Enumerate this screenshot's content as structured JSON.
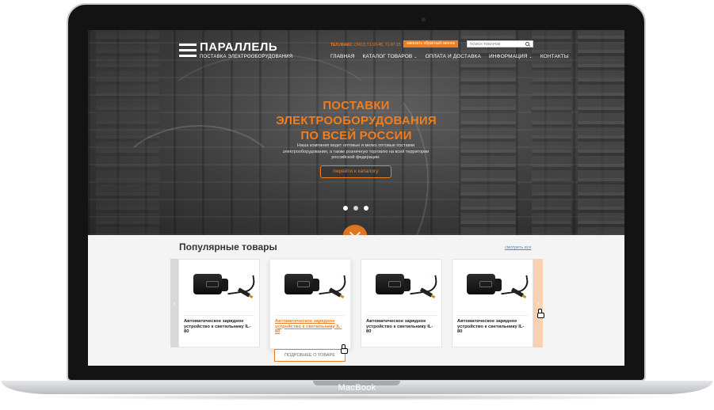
{
  "device": {
    "brand_label": "MacBook"
  },
  "header": {
    "logo_name": "ПАРАЛЛЕЛЬ",
    "logo_sub": "ПОСТАВКА ЭЛЕКТРООБОРУДОВАНИЯ",
    "phone_label": "ТЕЛ./ФАКС:",
    "phone_value": "(3412) 71-93-45, 71-97-15",
    "callback_label": "заказать обратный звонок",
    "search_placeholder": "ПОИСК ТОВАРОВ",
    "nav": [
      {
        "label": "ГЛАВНАЯ",
        "has_dropdown": false
      },
      {
        "label": "КАТАЛОГ ТОВАРОВ",
        "has_dropdown": true
      },
      {
        "label": "ОПЛАТА И ДОСТАВКА",
        "has_dropdown": false
      },
      {
        "label": "ИНФОРМАЦИЯ",
        "has_dropdown": true
      },
      {
        "label": "КОНТАКТЫ",
        "has_dropdown": false
      }
    ],
    "chevron_glyph": "⌄"
  },
  "hero": {
    "title_lines": [
      "ПОСТАВКИ",
      "ЭЛЕКТРООБОРУДОВАНИЯ",
      "ПО ВСЕЙ РОССИИ"
    ],
    "description": "Наша компания ведет оптовые и мелко оптовые поставки электрооборудования, а также розничную торговлю на всей территории российской федерации.",
    "cta_label": "перейти к каталогу",
    "slides_count": 3,
    "active_slide": 1
  },
  "popular": {
    "title": "Популярные товары",
    "see_all_label": "смотреть все",
    "prev_glyph": "‹",
    "next_glyph": "›",
    "details_button_label": "ПОДРОБНЕЕ О ТОВАРЕ",
    "products": [
      {
        "name": "Автоматическое зарядное устройство к светильнику IL-80",
        "highlighted": false
      },
      {
        "name": "Автоматическое зарядное устройство к светильнику IL-80",
        "highlighted": true
      },
      {
        "name": "Автоматическое зарядное устройство к светильнику IL-80",
        "highlighted": false
      },
      {
        "name": "Автоматическое зарядное устройство к светильнику IL-80",
        "highlighted": false
      }
    ]
  },
  "colors": {
    "accent": "#f07d1e",
    "link": "#3a8fd8",
    "section_bg": "#f4f4f4"
  }
}
